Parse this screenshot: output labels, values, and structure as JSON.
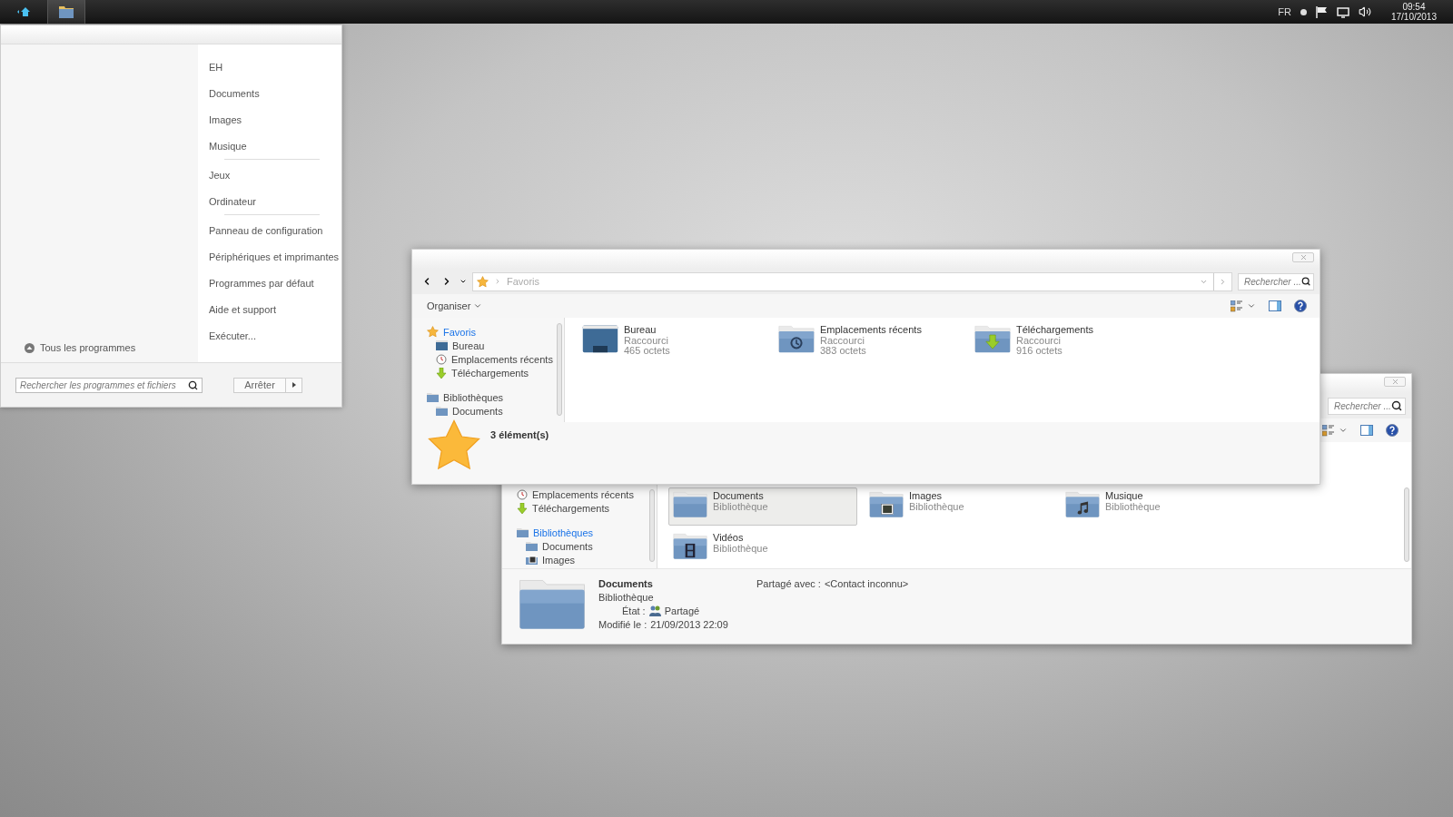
{
  "taskbar": {
    "pinned": [
      {
        "kind": "start",
        "selected": false
      },
      {
        "kind": "explorer",
        "selected": true
      }
    ],
    "language": "FR",
    "time": "09:54",
    "date": "17/10/2013"
  },
  "start_menu": {
    "places": [
      {
        "label": "EH",
        "separator_after": false
      },
      {
        "label": "Documents",
        "separator_after": false
      },
      {
        "label": "Images",
        "separator_after": false
      },
      {
        "label": "Musique",
        "separator_after": true
      },
      {
        "label": "Jeux",
        "separator_after": false
      },
      {
        "label": "Ordinateur",
        "separator_after": true
      },
      {
        "label": "Panneau de configuration",
        "separator_after": false
      },
      {
        "label": "Périphériques et imprimantes",
        "separator_after": false
      },
      {
        "label": "Programmes par défaut",
        "separator_after": false
      },
      {
        "label": "Aide et support",
        "separator_after": false
      },
      {
        "label": "Exécuter...",
        "separator_after": false
      }
    ],
    "all_programs": "Tous les programmes",
    "search": {
      "placeholder": "Rechercher les programmes et fichiers"
    },
    "shutdown": "Arrêter"
  },
  "front_window": {
    "address": "Favoris",
    "search": {
      "placeholder": "Rechercher ..."
    },
    "organize": "Organiser",
    "nav": [
      {
        "label": "Favoris",
        "kind": "star",
        "selected": true,
        "children": [
          {
            "label": "Bureau",
            "kind": "desktop",
            "selected": false
          },
          {
            "label": "Emplacements récents",
            "kind": "clock",
            "selected": false
          },
          {
            "label": "Téléchargements",
            "kind": "download",
            "selected": false
          }
        ]
      },
      {
        "label": "Bibliothèques",
        "kind": "library",
        "selected": false,
        "children": [
          {
            "label": "Documents",
            "kind": "library",
            "selected": false
          }
        ]
      }
    ],
    "items": [
      {
        "name": "Bureau",
        "type": "Raccourci",
        "size": "465 octets",
        "kind": "desktop"
      },
      {
        "name": "Emplacements récents",
        "type": "Raccourci",
        "size": "383 octets",
        "kind": "clock"
      },
      {
        "name": "Téléchargements",
        "type": "Raccourci",
        "size": "916 octets",
        "kind": "download"
      }
    ],
    "status": "3 élément(s)"
  },
  "back_window": {
    "search": {
      "placeholder": "Rechercher ..."
    },
    "nav": [
      {
        "label": "Emplacements récents",
        "kind": "clock",
        "selected": false
      },
      {
        "label": "Téléchargements",
        "kind": "download",
        "selected": false
      },
      {
        "label": "Bibliothèques",
        "kind": "library",
        "selected": true,
        "children": [
          {
            "label": "Documents",
            "kind": "library",
            "selected": false
          },
          {
            "label": "Images",
            "kind": "images",
            "selected": false
          }
        ]
      }
    ],
    "items": [
      {
        "name": "Documents",
        "type": "Bibliothèque",
        "kind": "library",
        "selected": true
      },
      {
        "name": "Images",
        "type": "Bibliothèque",
        "kind": "images",
        "selected": false
      },
      {
        "name": "Musique",
        "type": "Bibliothèque",
        "kind": "music",
        "selected": false
      },
      {
        "name": "Vidéos",
        "type": "Bibliothèque",
        "kind": "video",
        "selected": false
      }
    ],
    "details": {
      "title": "Documents",
      "type": "Bibliothèque",
      "fields": [
        {
          "label": "État :",
          "value": "Partagé",
          "kind": "shared"
        },
        {
          "label": "Modifié le :",
          "value": "21/09/2013 22:09",
          "kind": "plain"
        }
      ],
      "shared_label": "Partagé avec :",
      "shared_value": "<Contact inconnu>"
    }
  }
}
